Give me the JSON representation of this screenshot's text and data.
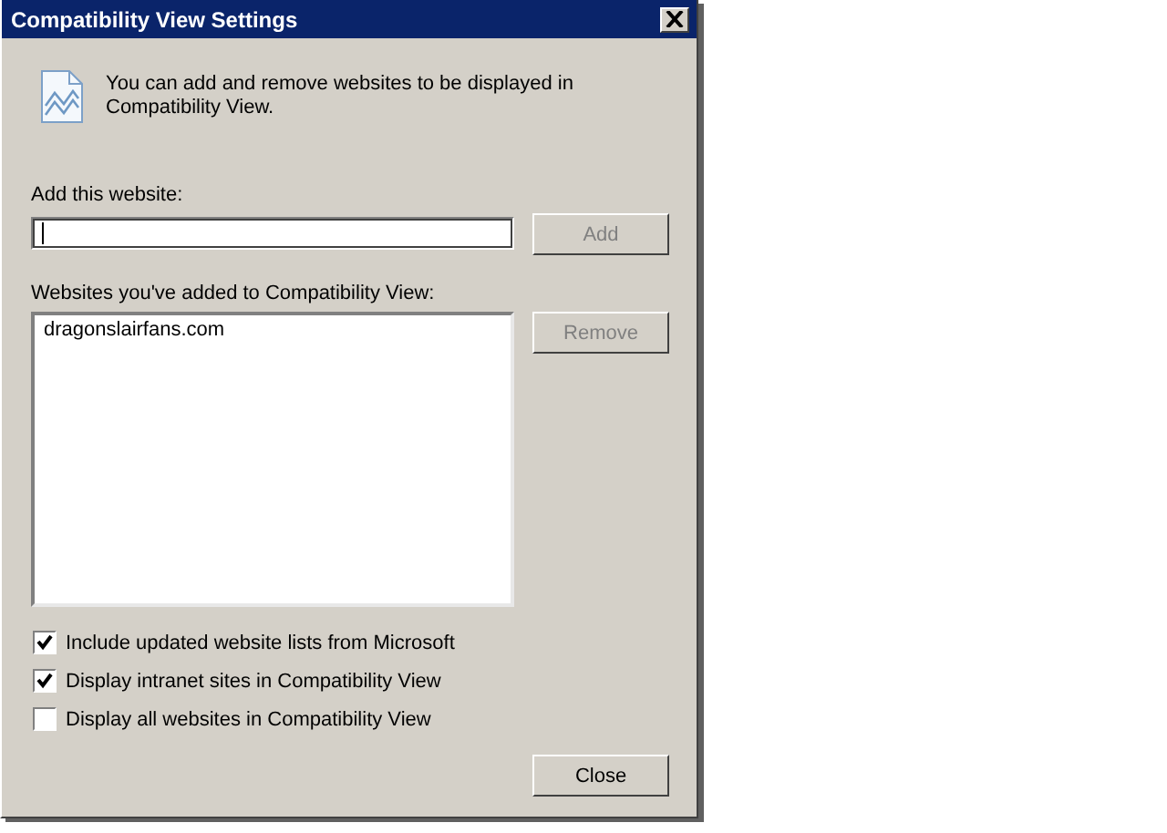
{
  "window": {
    "title": "Compatibility View Settings"
  },
  "intro": "You can add and remove websites to be displayed in Compatibility View.",
  "add_field": {
    "label": "Add this website:",
    "focused": true
  },
  "add_button": {
    "label": "Add",
    "disabled": true
  },
  "list": {
    "label": "Websites you've added to Compatibility View:",
    "items": [
      {
        "label": "dragonslairfans.com",
        "selected": false
      }
    ]
  },
  "remove_button": {
    "label": "Remove",
    "disabled": true
  },
  "options": [
    {
      "label": "Include updated website lists from Microsoft",
      "checked": true
    },
    {
      "label": "Display intranet sites in Compatibility View",
      "checked": true
    },
    {
      "label": "Display all websites in Compatibility View",
      "checked": false
    }
  ],
  "close_button": {
    "label": "Close",
    "disabled": false
  }
}
